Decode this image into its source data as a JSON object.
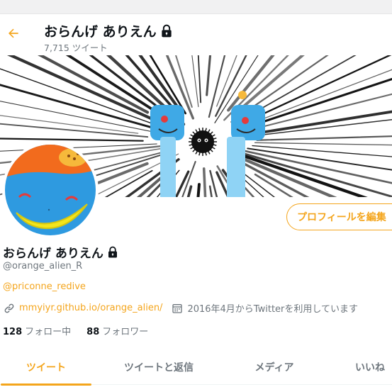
{
  "header": {
    "name": "おらんげ ありえん",
    "tweet_count": "7,715 ツイート"
  },
  "profile": {
    "edit_button": "プロフィールを編集",
    "name": "おらんげ ありえん",
    "handle": "@orange_alien_R",
    "bio_link": "@priconne_redive",
    "website": "mmyiyr.github.io/orange_alien/",
    "joined": "2016年4月からTwitterを利用しています",
    "following_count": "128",
    "following_label": "フォロー中",
    "followers_count": "88",
    "followers_label": "フォロワー"
  },
  "tabs": [
    {
      "label": "ツイート",
      "active": true
    },
    {
      "label": "ツイートと返信",
      "active": false
    },
    {
      "label": "メディア",
      "active": false
    },
    {
      "label": "いいね",
      "active": false
    }
  ],
  "colors": {
    "accent": "#f4a51c",
    "secondary_text": "#6e767d"
  },
  "icons": [
    "back-arrow-icon",
    "lock-icon",
    "link-icon",
    "calendar-icon"
  ]
}
